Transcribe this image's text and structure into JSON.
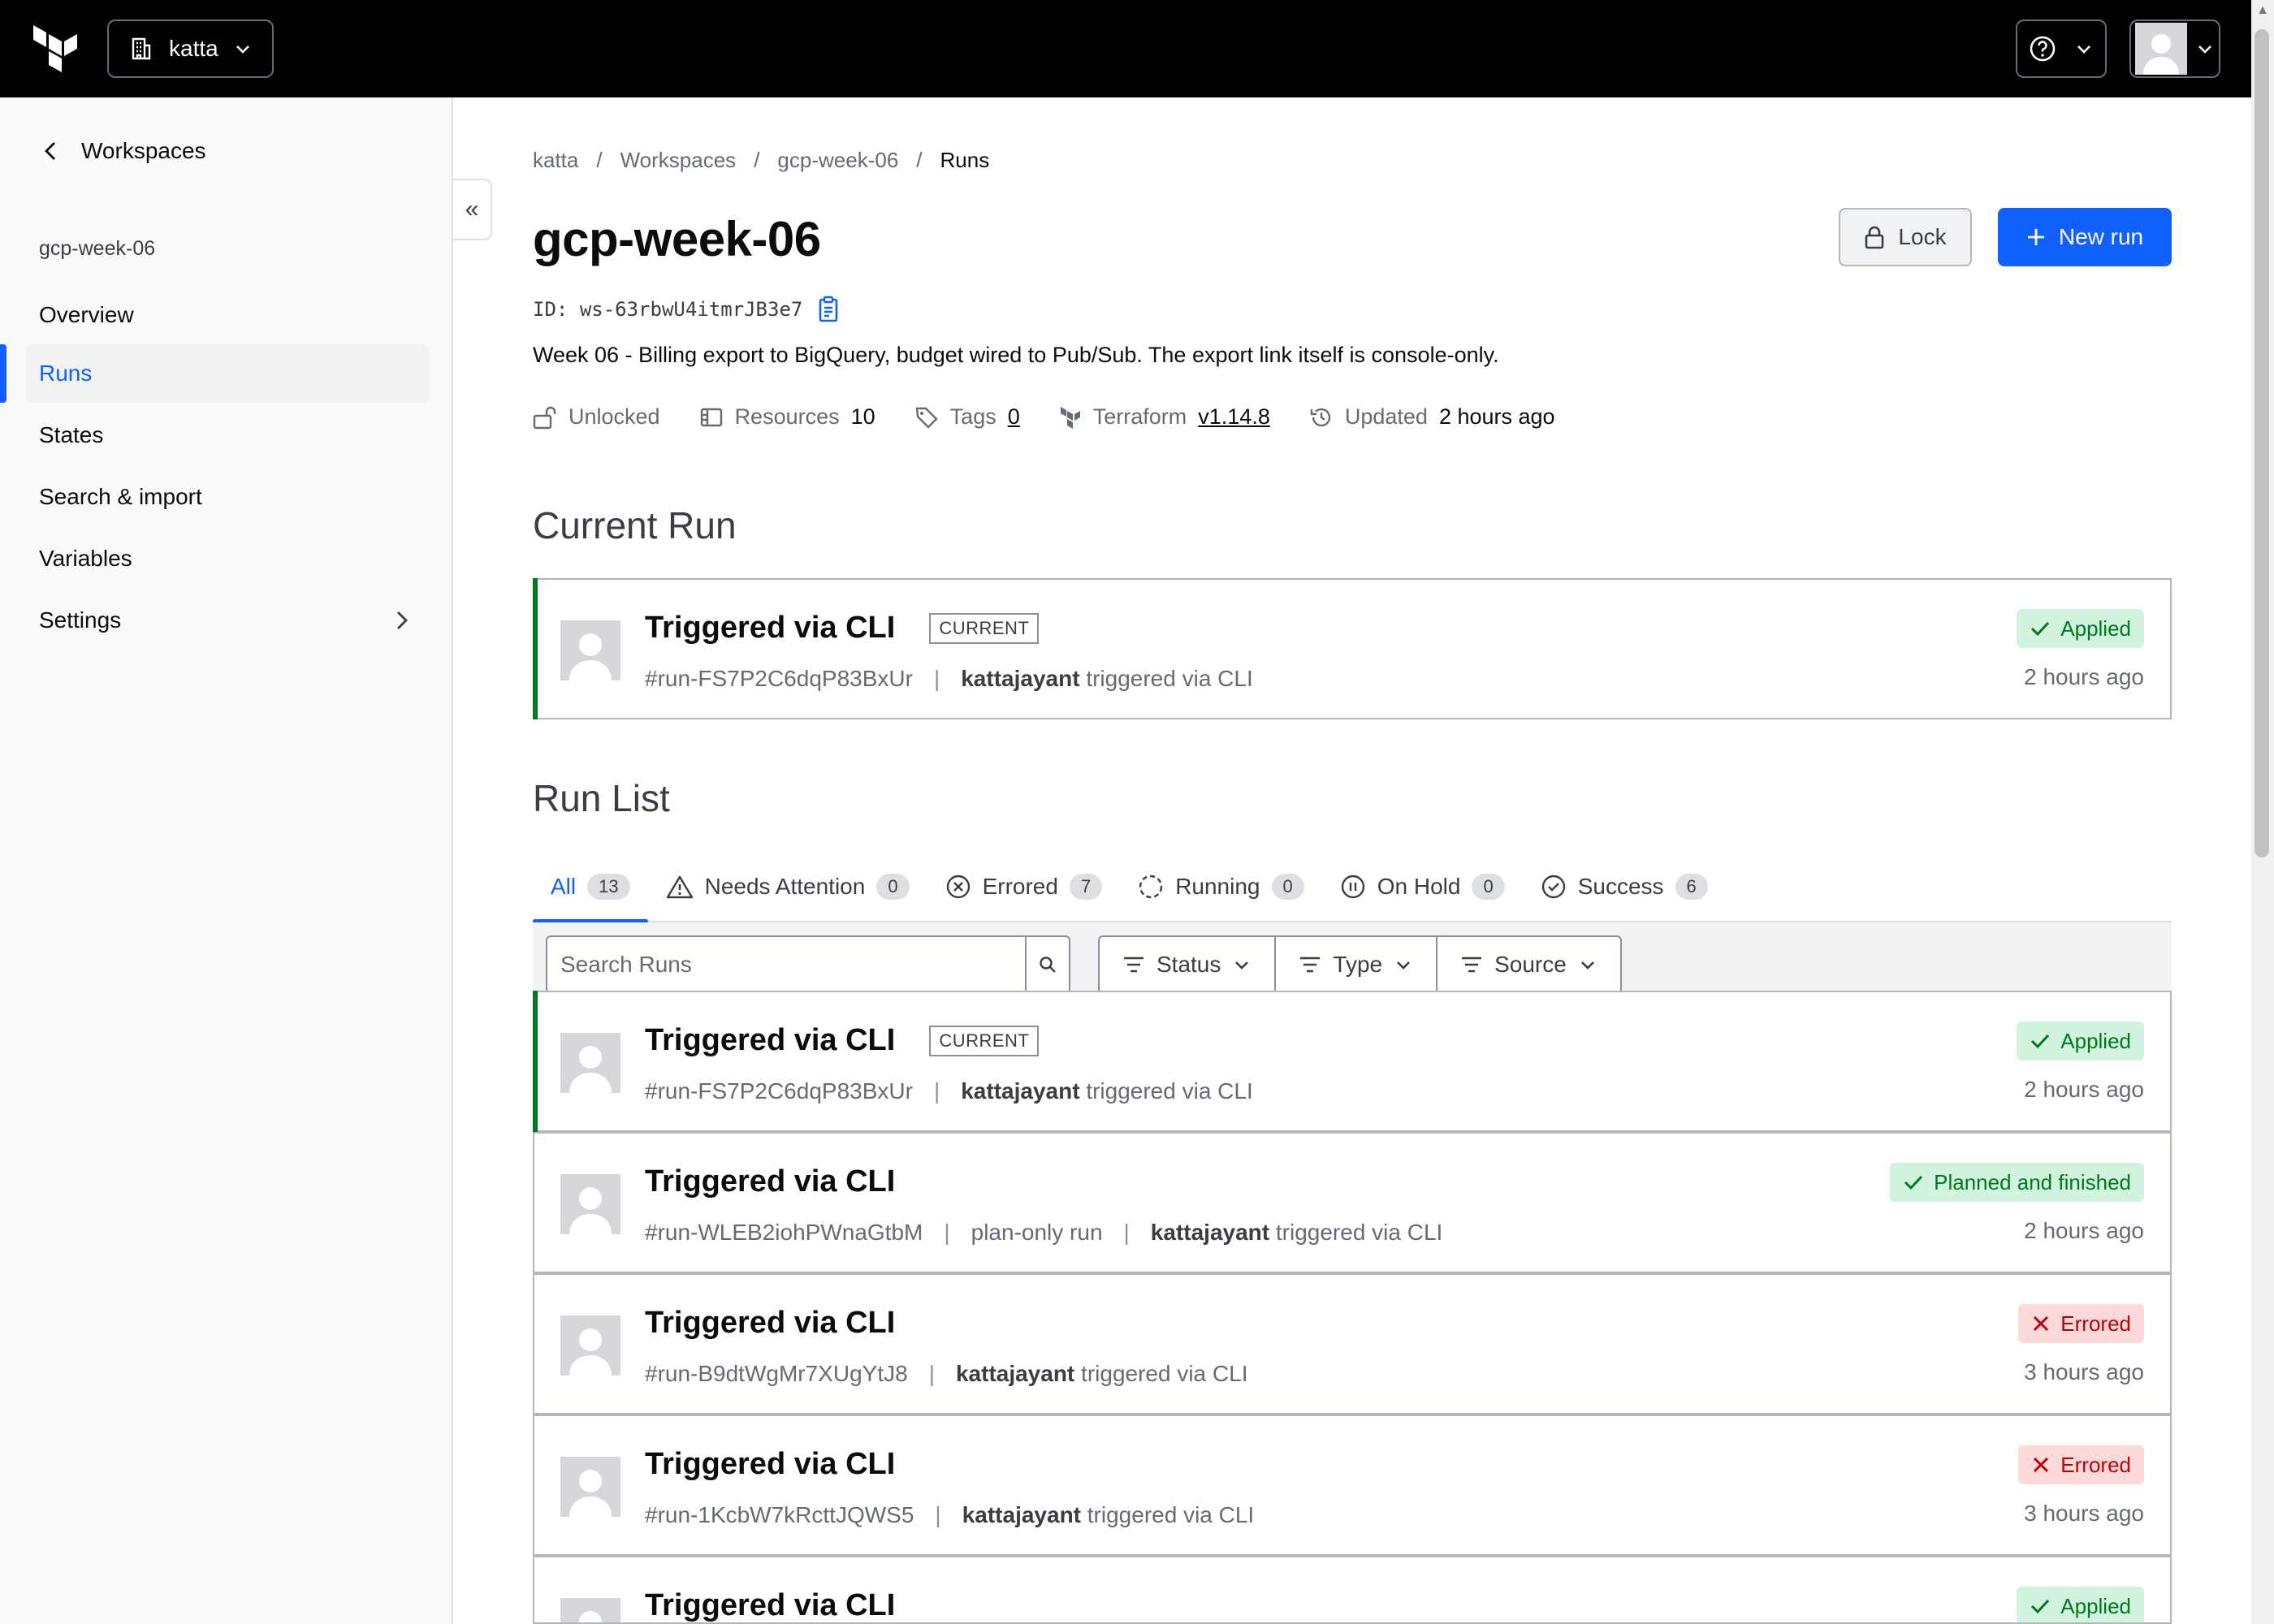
{
  "topnav": {
    "org_name": "katta"
  },
  "sidebar": {
    "back_label": "Workspaces",
    "workspace_name": "gcp-week-06",
    "items": [
      {
        "label": "Overview"
      },
      {
        "label": "Runs"
      },
      {
        "label": "States"
      },
      {
        "label": "Search & import"
      },
      {
        "label": "Variables"
      },
      {
        "label": "Settings"
      }
    ]
  },
  "breadcrumb": [
    "katta",
    "/",
    "Workspaces",
    "/",
    "gcp-week-06",
    "/",
    "Runs"
  ],
  "header": {
    "title": "gcp-week-06",
    "id_label": "ID:",
    "id_value": "ws-63rbwU4itmrJB3e7",
    "description": "Week 06 - Billing export to BigQuery, budget wired to Pub/Sub. The export link itself is console-only.",
    "lock_label": "Lock",
    "new_run_label": "New run"
  },
  "meta": {
    "lock_state": "Unlocked",
    "resources_label": "Resources",
    "resources_count": "10",
    "tags_label": "Tags",
    "tags_count": "0",
    "terraform_label": "Terraform",
    "terraform_version": "v1.14.8",
    "updated_label": "Updated",
    "updated_value": "2 hours ago"
  },
  "current_run": {
    "heading": "Current Run",
    "title": "Triggered via CLI",
    "tag": "CURRENT",
    "run_id": "#run-FS7P2C6dqP83BxUr",
    "user": "kattajayant",
    "trigger_text": "triggered via CLI",
    "status": "Applied",
    "time": "2 hours ago"
  },
  "run_list": {
    "heading": "Run List",
    "tabs": [
      {
        "label": "All",
        "count": "13"
      },
      {
        "label": "Needs Attention",
        "count": "0"
      },
      {
        "label": "Errored",
        "count": "7"
      },
      {
        "label": "Running",
        "count": "0"
      },
      {
        "label": "On Hold",
        "count": "0"
      },
      {
        "label": "Success",
        "count": "6"
      }
    ],
    "search_placeholder": "Search Runs",
    "filters": [
      {
        "label": "Status"
      },
      {
        "label": "Type"
      },
      {
        "label": "Source"
      }
    ],
    "runs": [
      {
        "title": "Triggered via CLI",
        "tag": "CURRENT",
        "run_id": "#run-FS7P2C6dqP83BxUr",
        "extra": "",
        "user": "kattajayant",
        "trigger_text": "triggered via CLI",
        "status": "Applied",
        "time": "2 hours ago"
      },
      {
        "title": "Triggered via CLI",
        "tag": "",
        "run_id": "#run-WLEB2iohPWnaGtbM",
        "extra": "plan-only run",
        "user": "kattajayant",
        "trigger_text": "triggered via CLI",
        "status": "Planned and finished",
        "time": "2 hours ago"
      },
      {
        "title": "Triggered via CLI",
        "tag": "",
        "run_id": "#run-B9dtWgMr7XUgYtJ8",
        "extra": "",
        "user": "kattajayant",
        "trigger_text": "triggered via CLI",
        "status": "Errored",
        "time": "3 hours ago"
      },
      {
        "title": "Triggered via CLI",
        "tag": "",
        "run_id": "#run-1KcbW7kRcttJQWS5",
        "extra": "",
        "user": "kattajayant",
        "trigger_text": "triggered via CLI",
        "status": "Errored",
        "time": "3 hours ago"
      },
      {
        "title": "Triggered via CLI",
        "tag": "",
        "run_id": "",
        "extra": "",
        "user": "",
        "trigger_text": "",
        "status": "Applied",
        "time": ""
      }
    ]
  },
  "colors": {
    "accent": "#1060ff",
    "success_bg": "#d2f4df",
    "success_fg": "#00781e",
    "error_bg": "#fcd9da",
    "error_fg": "#c00005",
    "topnav_bg": "#000000"
  }
}
